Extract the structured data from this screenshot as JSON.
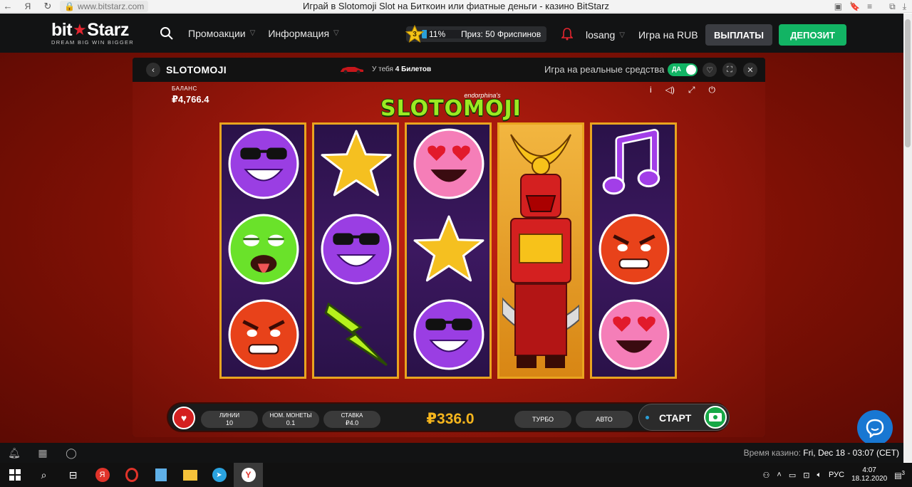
{
  "browser": {
    "url": "www.bitstarz.com",
    "title": "Играй в Slotomoji Slot на Биткоин или фиатные деньги - казино BitStarz",
    "yandex_btn": "Я"
  },
  "header": {
    "logo": {
      "part1": "bit",
      "part2": "Starz",
      "tagline": "DREAM BIG WIN BIGGER"
    },
    "nav": [
      {
        "label": "Промоакции"
      },
      {
        "label": "Информация"
      }
    ],
    "level": {
      "number": "3",
      "progress_pct": 11,
      "progress_label": "11%",
      "prize": "Приз: 50 Фриспинов"
    },
    "username": "losang",
    "currency_label": "Игра на RUB",
    "payout_button": "ВЫПЛАТЫ",
    "deposit_button": "ДЕПОЗИТ"
  },
  "game_bar": {
    "title": "SLOTOMOJI",
    "tickets_prefix": "У тебя",
    "tickets_count": "4 Билетов",
    "real_money_label": "Игра на реальные средства",
    "toggle_label": "ДА"
  },
  "game": {
    "balance_label": "БАЛАНС",
    "balance_value": "₽4,766.4",
    "provider": "endorphina's",
    "logo": "SLOTOMOJI",
    "icons": [
      "info-icon",
      "sound-icon",
      "fullscreen-icon",
      "power-icon"
    ],
    "reels": [
      [
        "cool-purple-emoji",
        "sick-green-emoji",
        "angry-red-emoji"
      ],
      [
        "star-symbol",
        "cool-purple-emoji",
        "lightning-symbol"
      ],
      [
        "heart-eyes-pink-emoji",
        "star-symbol",
        "cool-purple-emoji"
      ],
      [
        "samurai-wild"
      ],
      [
        "music-note-symbol",
        "angry-red-emoji",
        "heart-eyes-pink-emoji"
      ]
    ],
    "controls": {
      "lines_label": "ЛИНИИ",
      "lines_value": "10",
      "coin_label": "НОМ. МОНЕТЫ",
      "coin_value": "0.1",
      "bet_label": "СТАВКА",
      "bet_value": "₽4.0",
      "total": "₽336.0",
      "turbo": "ТУРБО",
      "auto": "АВТО",
      "start": "СТАРТ"
    }
  },
  "footer": {
    "casino_time_label": "Время казино:",
    "casino_time_value": "Fri, Dec 18 - 03:07 (CET)"
  },
  "taskbar": {
    "language": "РУС",
    "time": "4:07",
    "date": "18.12.2020",
    "notifications": "3"
  },
  "colors": {
    "brand_red": "#e4252f",
    "deposit_green": "#12b464",
    "reel_border": "#e9a41f",
    "total_gold": "#f5b51d"
  }
}
